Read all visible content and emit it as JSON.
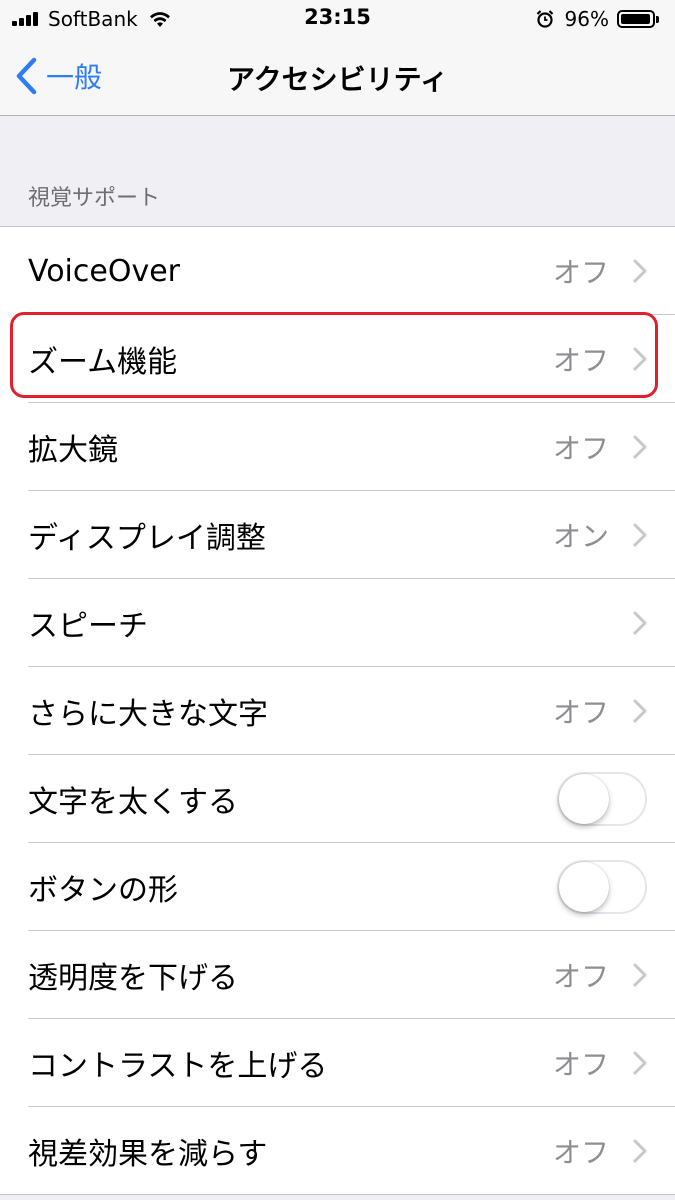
{
  "status_bar": {
    "carrier": "SoftBank",
    "time": "23:15",
    "battery_percent": "96%",
    "battery_level": 0.96,
    "icons": [
      "signal-icon",
      "wifi-icon",
      "alarm-icon",
      "battery-icon"
    ]
  },
  "nav": {
    "back_label": "一般",
    "title": "アクセシビリティ"
  },
  "section": {
    "header": "視覚サポート"
  },
  "rows": [
    {
      "label": "VoiceOver",
      "value": "オフ",
      "type": "disclosure"
    },
    {
      "label": "ズーム機能",
      "value": "オフ",
      "type": "disclosure"
    },
    {
      "label": "拡大鏡",
      "value": "オフ",
      "type": "disclosure"
    },
    {
      "label": "ディスプレイ調整",
      "value": "オン",
      "type": "disclosure"
    },
    {
      "label": "スピーチ",
      "value": "",
      "type": "disclosure"
    },
    {
      "label": "さらに大きな文字",
      "value": "オフ",
      "type": "disclosure"
    },
    {
      "label": "文字を太くする",
      "type": "toggle",
      "on": false
    },
    {
      "label": "ボタンの形",
      "type": "toggle",
      "on": false
    },
    {
      "label": "透明度を下げる",
      "value": "オフ",
      "type": "disclosure"
    },
    {
      "label": "コントラストを上げる",
      "value": "オフ",
      "type": "disclosure"
    },
    {
      "label": "視差効果を減らす",
      "value": "オフ",
      "type": "disclosure"
    }
  ],
  "colors": {
    "accent": "#2f7cf6",
    "highlight": "#e0202c",
    "background": "#efeff4"
  }
}
